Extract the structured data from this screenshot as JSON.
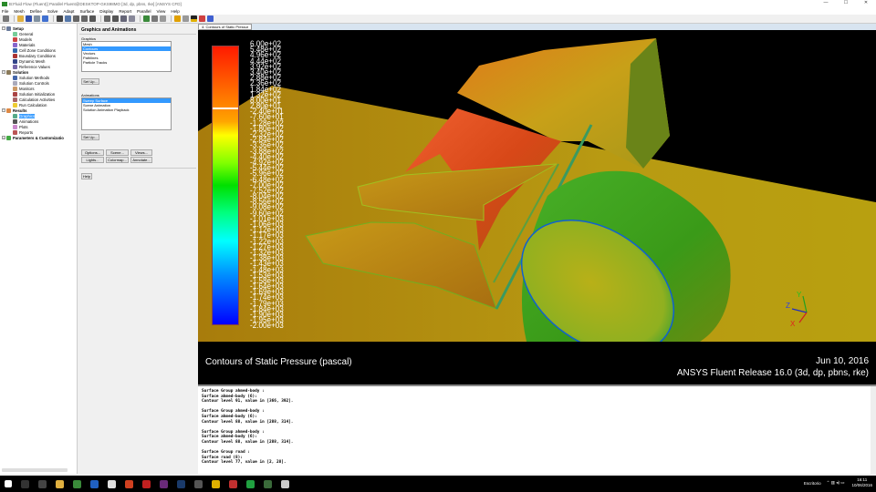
{
  "window": {
    "title": "B:Fluid Flow (Fluent)] Parallel Fluent@DESKTOP-GKS98MO  [3d, dp, pbns, rke] [ANSYS CFD]",
    "controls": [
      "—",
      "☐",
      "✕"
    ]
  },
  "menu": [
    "File",
    "Mesh",
    "Define",
    "Solve",
    "Adapt",
    "Surface",
    "Display",
    "Report",
    "Parallel",
    "View",
    "Help"
  ],
  "tree": {
    "setup": {
      "label": "Setup",
      "items": [
        "General",
        "Models",
        "Materials",
        "Cell Zone Conditions",
        "Boundary Conditions",
        "Dynamic Mesh",
        "Reference Values"
      ]
    },
    "solution": {
      "label": "Solution",
      "items": [
        "Solution Methods",
        "Solution Controls",
        "Monitors",
        "Solution Initialization",
        "Calculation Activities",
        "Run Calculation"
      ]
    },
    "results": {
      "label": "Results",
      "items": [
        "Graphics",
        "Animations",
        "Plots",
        "Reports"
      ]
    },
    "params": {
      "label": "Parameters & Customizatio"
    }
  },
  "task": {
    "title": "Graphics and Animations",
    "graphics_label": "Graphics",
    "graphics_items": [
      "Mesh",
      "Contours",
      "Vectors",
      "Pathlines",
      "Particle Tracks"
    ],
    "graphics_selected": "Contours",
    "setup1": "Set Up...",
    "animations_label": "Animations",
    "animations_items": [
      "Sweep Surface",
      "Scene Animation",
      "Solution Animation Playback"
    ],
    "setup2": "Set Up...",
    "buttons": [
      "Options...",
      "Scene...",
      "Views...",
      "Lights...",
      "Colormap...",
      "Annotate..."
    ],
    "help": "Help"
  },
  "graphics": {
    "tab": "4: Contours of Static Pressur",
    "title": "Contours of Static Pressure (pascal)",
    "date": "Jun 10, 2016",
    "release": "ANSYS Fluent Release 16.0 (3d, dp, pbns, rke)",
    "colorbar_labels": [
      "6.00e+02",
      "5.48e+02",
      "4.96e+02",
      "4.44e+02",
      "3.92e+02",
      "3.40e+02",
      "2.88e+02",
      "2.36e+02",
      "1.84e+02",
      "1.32e+02",
      "8.00e+01",
      "2.80e+01",
      "-2.40e+01",
      "-7.60e+01",
      "-1.28e+02",
      "-1.80e+02",
      "-2.32e+02",
      "-2.84e+02",
      "-3.36e+02",
      "-3.88e+02",
      "-4.40e+02",
      "-4.92e+02",
      "-5.44e+02",
      "-5.96e+02",
      "-6.48e+02",
      "-7.00e+02",
      "-7.52e+02",
      "-8.04e+02",
      "-8.56e+02",
      "-9.08e+02",
      "-9.60e+02",
      "-1.01e+03",
      "-1.06e+03",
      "-1.12e+03",
      "-1.17e+03",
      "-1.22e+03",
      "-1.27e+03",
      "-1.32e+03",
      "-1.38e+03",
      "-1.43e+03",
      "-1.48e+03",
      "-1.53e+03",
      "-1.58e+03",
      "-1.64e+03",
      "-1.69e+03",
      "-1.74e+03",
      "-1.79e+03",
      "-1.84e+03",
      "-1.90e+03",
      "-1.95e+03",
      "-2.00e+03"
    ],
    "axes": {
      "x": "X",
      "y": "Y",
      "z": "Z"
    }
  },
  "console": [
    "Surface Group ahmed-body :",
    "Surface ahmed-body (6):",
    "Contour level 91, value in [366, 392].",
    "",
    "Surface Group ahmed-body :",
    "Surface ahmed-body (6):",
    "Contour level 88, value in [288, 314].",
    "",
    "Surface Group ahmed-body :",
    "Surface ahmed-body (6):",
    "Contour level 88, value in [288, 314].",
    "",
    "Surface Group road :",
    "Surface road (8):",
    "Contour level 77, value in [2, 28]."
  ],
  "taskbar": {
    "desktop": "Escritorio",
    "time": "16:11",
    "date": "10/06/2016"
  }
}
